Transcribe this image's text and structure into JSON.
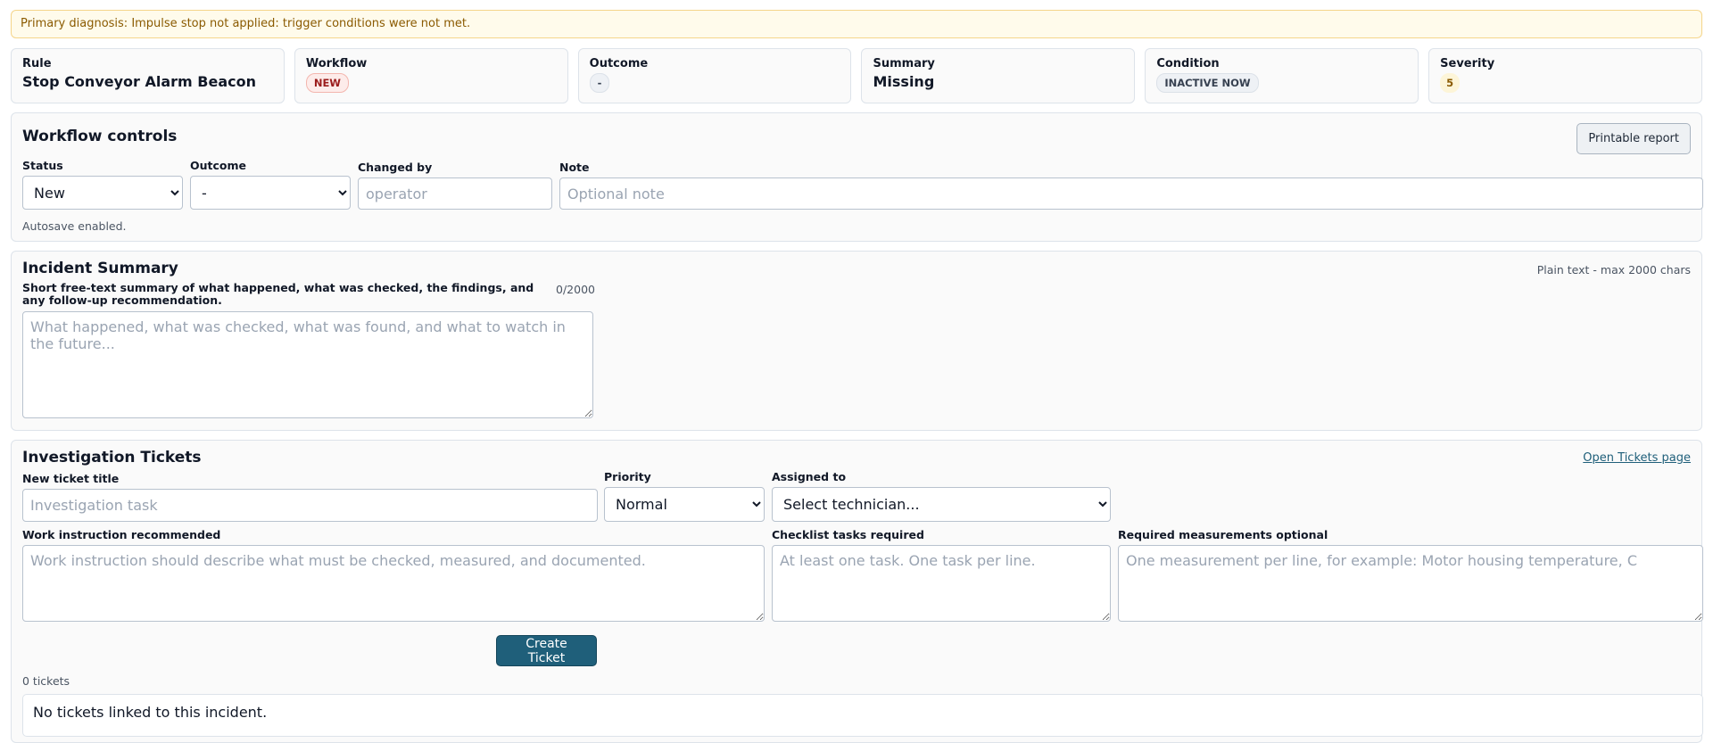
{
  "alert": {
    "text": "Primary diagnosis: Impulse stop not applied: trigger conditions were not met."
  },
  "cards": {
    "rule": {
      "label": "Rule",
      "value": "Stop Conveyor Alarm Beacon"
    },
    "workflow": {
      "label": "Workflow",
      "badge": "NEW"
    },
    "outcome": {
      "label": "Outcome",
      "badge": "-"
    },
    "summary": {
      "label": "Summary",
      "value": "Missing"
    },
    "condition": {
      "label": "Condition",
      "badge": "INACTIVE NOW"
    },
    "severity": {
      "label": "Severity",
      "badge": "5"
    }
  },
  "workflow_controls": {
    "title": "Workflow controls",
    "report_button": "Printable report",
    "status_label": "Status",
    "status_value": "New",
    "outcome_label": "Outcome",
    "outcome_value": "-",
    "changed_by_label": "Changed by",
    "changed_by_placeholder": "operator",
    "note_label": "Note",
    "note_placeholder": "Optional note",
    "autosave": "Autosave enabled."
  },
  "incident_summary": {
    "title": "Incident Summary",
    "hint": "Plain text - max 2000 chars",
    "field_label": "Short free-text summary of what happened, what was checked, the findings, and any follow-up recommendation.",
    "counter": "0/2000",
    "placeholder": "What happened, what was checked, what was found, and what to watch in the future..."
  },
  "tickets": {
    "title": "Investigation Tickets",
    "open_link": "Open Tickets page",
    "title_label": "New ticket title",
    "title_placeholder": "Investigation task",
    "priority_label": "Priority",
    "priority_value": "Normal",
    "assigned_label": "Assigned to",
    "assigned_value": "Select technician...",
    "work_label": "Work instruction recommended",
    "work_placeholder": "Work instruction should describe what must be checked, measured, and documented.",
    "checklist_label": "Checklist tasks required",
    "checklist_placeholder": "At least one task. One task per line.",
    "measure_label": "Required measurements optional",
    "measure_placeholder": "One measurement per line, for example: Motor housing temperature, C",
    "create_button": "Create Ticket",
    "count": "0 tickets",
    "empty": "No tickets linked to this incident."
  }
}
